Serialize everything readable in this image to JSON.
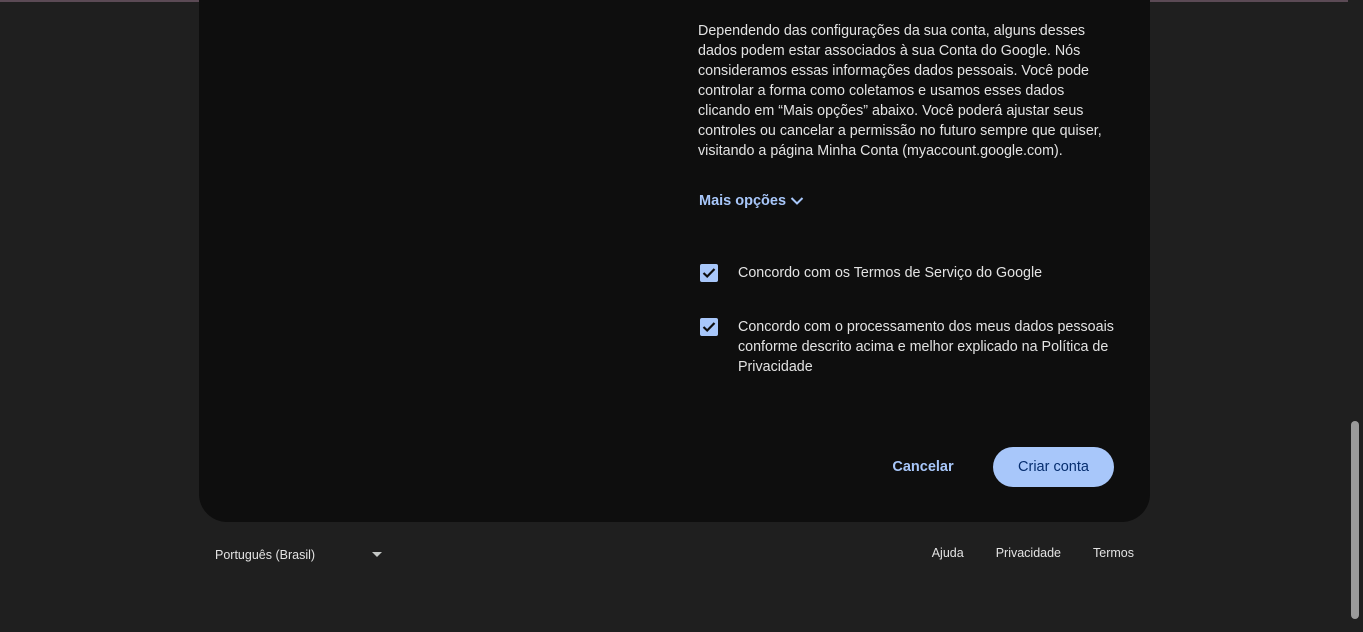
{
  "privacy_text": "Dependendo das configurações da sua conta, alguns desses dados podem estar associados à sua Conta do Google. Nós consideramos essas informações dados pessoais. Você pode controlar a forma como coletamos e usamos esses dados clicando em “Mais opções” abaixo. Você poderá ajustar seus controles ou cancelar a permissão no futuro sempre que quiser, visitando a página Minha Conta (myaccount.google.com).",
  "more_options": {
    "label": "Mais opções",
    "icon": "chevron-down-icon"
  },
  "agreements": [
    {
      "checked": true,
      "label": "Concordo com os Termos de Serviço do Google"
    },
    {
      "checked": true,
      "label": "Concordo com o processamento dos meus dados pessoais conforme descrito acima e melhor explicado na Política de Privacidade"
    }
  ],
  "actions": {
    "cancel_label": "Cancelar",
    "create_label": "Criar conta"
  },
  "footer": {
    "language": "Português (Brasil)",
    "links": [
      "Ajuda",
      "Privacidade",
      "Termos"
    ]
  },
  "colors": {
    "accent": "#a8c7fa",
    "background": "#1f1f1f",
    "card": "#0e0e0e",
    "text": "#e3e3e3"
  }
}
